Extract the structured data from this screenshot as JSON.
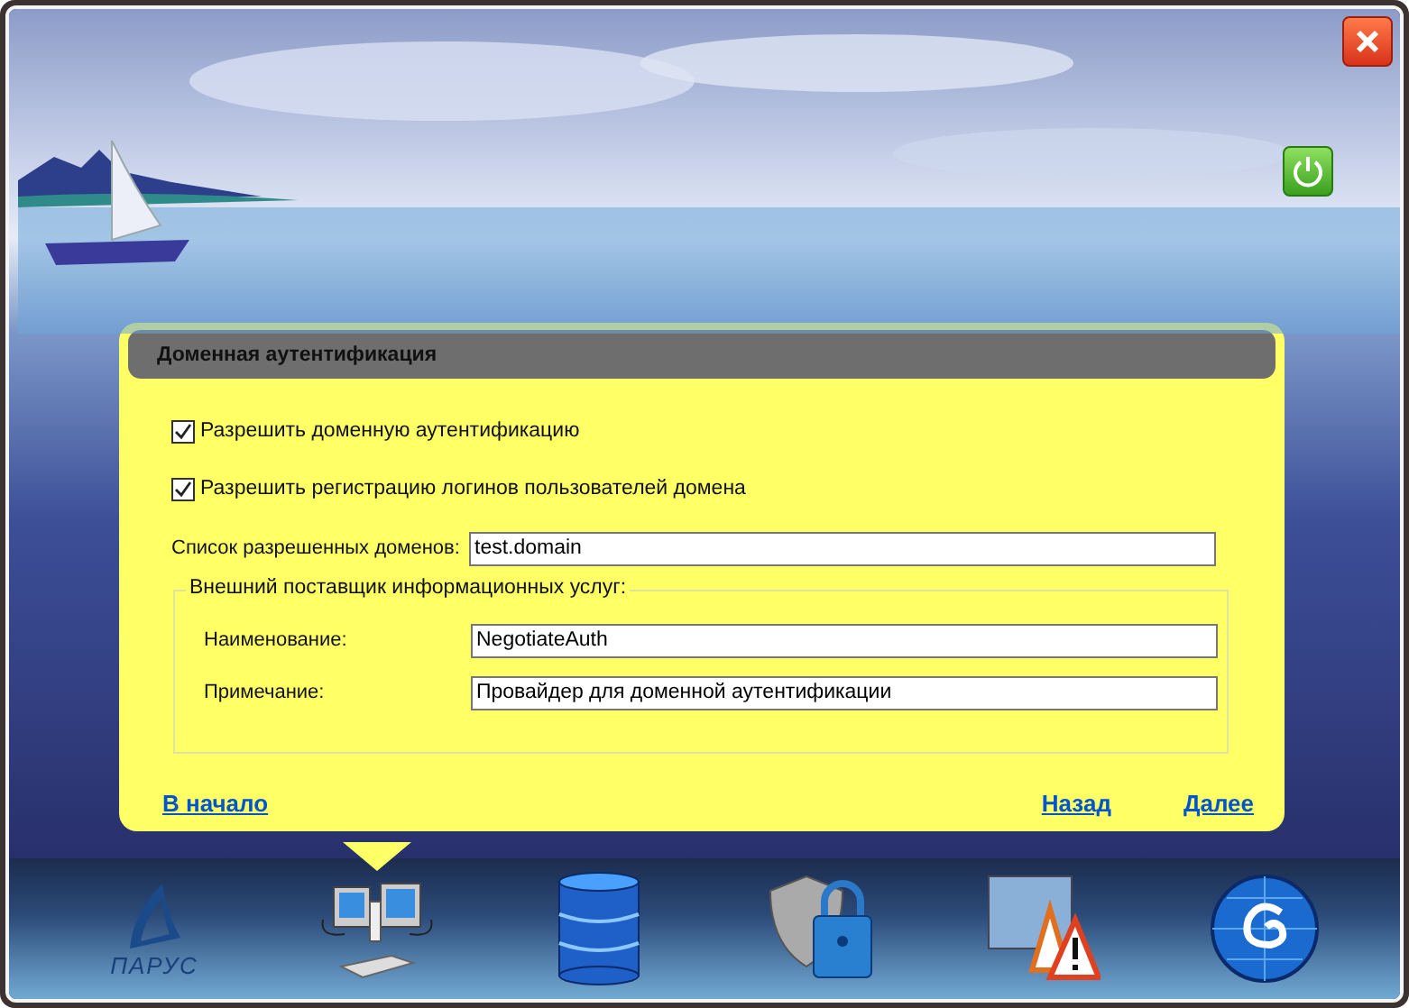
{
  "panel": {
    "title": "Доменная аутентификация",
    "checkboxes": [
      {
        "label": "Разрешить доменную аутентификацию",
        "checked": true
      },
      {
        "label": "Разрешить регистрацию логинов пользователей домена",
        "checked": true
      }
    ],
    "domains_field": {
      "label": "Список разрешенных доменов:",
      "value": "test.domain"
    },
    "provider_group": {
      "title": "Внешний поставщик информационных услуг:",
      "fields": [
        {
          "label": "Наименование:",
          "value": "NegotiateAuth"
        },
        {
          "label": "Примечание:",
          "value": "Провайдер для доменной аутентификации"
        }
      ]
    },
    "links": {
      "start": "В начало",
      "back": "Назад",
      "next": "Далее"
    }
  },
  "nav": [
    {
      "kind": "logo",
      "label": "ПАРУС",
      "selected": false
    },
    {
      "kind": "network",
      "selected": true
    },
    {
      "kind": "database",
      "selected": false
    },
    {
      "kind": "security",
      "selected": false
    },
    {
      "kind": "warnings",
      "selected": false
    },
    {
      "kind": "globe",
      "selected": false
    }
  ]
}
